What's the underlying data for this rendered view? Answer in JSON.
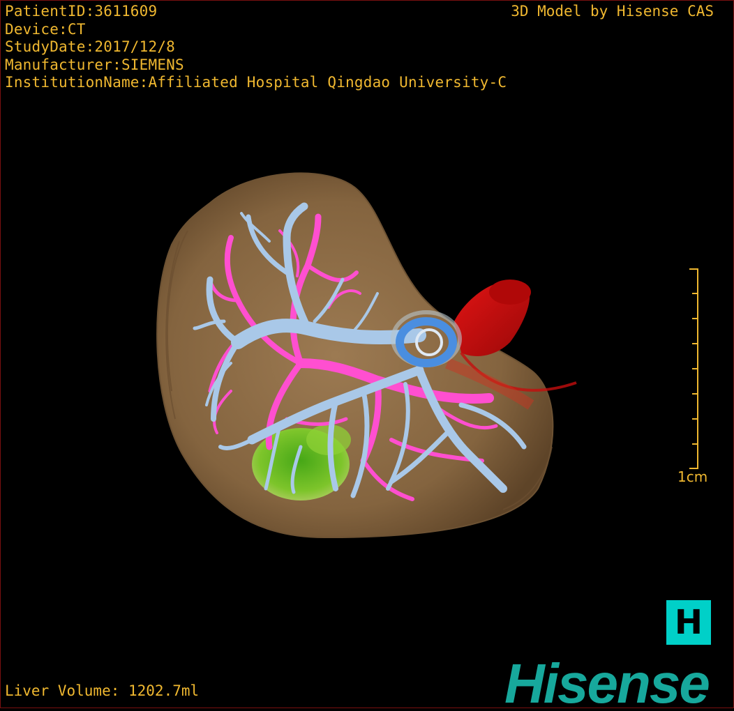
{
  "patient_info": {
    "patient_id": "PatientID:3611609",
    "device": "Device:CT",
    "study_date": "StudyDate:2017/12/8",
    "manufacturer": "Manufacturer:SIEMENS",
    "institution": "InstitutionName:Affiliated Hospital Qingdao University-C"
  },
  "credit": "3D Model by Hisense CAS",
  "liver_volume": "Liver Volume: 1202.7ml",
  "scale": {
    "label": "1cm"
  },
  "home_button": {
    "label": "H"
  },
  "brand": {
    "name": "Hisense"
  },
  "colors": {
    "text": "#f0b830",
    "liver": "#8a6a48",
    "portal_vein": "#ff4fd0",
    "hepatic_vein": "#a9c8e8",
    "vena_cava": "#c40e0e",
    "lesion": "#6cc21c",
    "ring": "#4a8ee0",
    "brand": "#17a89c",
    "home_button": "#00d0c8"
  },
  "model_parts": [
    "liver-surface",
    "hepatic-vein-tree",
    "portal-vein-tree",
    "vena-cava",
    "lesion",
    "vessel-ring"
  ]
}
